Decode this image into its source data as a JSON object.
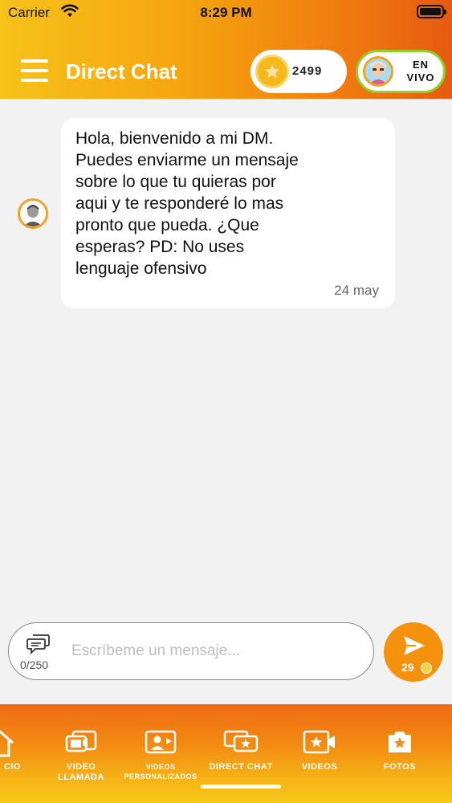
{
  "status_bar": {
    "carrier": "Carrier",
    "time": "8:29 PM"
  },
  "header": {
    "title": "Direct Chat",
    "coins": "2499",
    "live_line1": "EN",
    "live_line2": "VIVO"
  },
  "chat": {
    "messages": [
      {
        "text": "Hola, bienvenido a mi DM. Puedes enviarme un mensaje sobre lo que tu quieras por aqui y te responderé lo mas pronto que pueda. ¿Que esperas? PD: No uses lenguaje ofensivo",
        "date": "24 may"
      }
    ]
  },
  "composer": {
    "placeholder": "Escríbeme un mensaje...",
    "counter": "0/250",
    "send_cost": "29"
  },
  "nav": {
    "items": [
      {
        "label": "CIO",
        "icon": "home-icon"
      },
      {
        "label_line1": "VIDEO",
        "label_line2": "LLAMADA",
        "icon": "video-call-icon"
      },
      {
        "label_line1": "VIDEOS",
        "label_line2": "PERSONALIZADOS",
        "icon": "personalized-videos-icon"
      },
      {
        "label": "DIRECT CHAT",
        "icon": "direct-chat-icon"
      },
      {
        "label": "VIDEOS",
        "icon": "videos-icon"
      },
      {
        "label": "FOTOS",
        "icon": "photos-icon"
      }
    ],
    "active": "DIRECT CHAT"
  },
  "colors": {
    "accent": "#f5920d",
    "live_border": "#8ed12a",
    "header_start": "#f7c21a",
    "header_end": "#e85a10"
  }
}
